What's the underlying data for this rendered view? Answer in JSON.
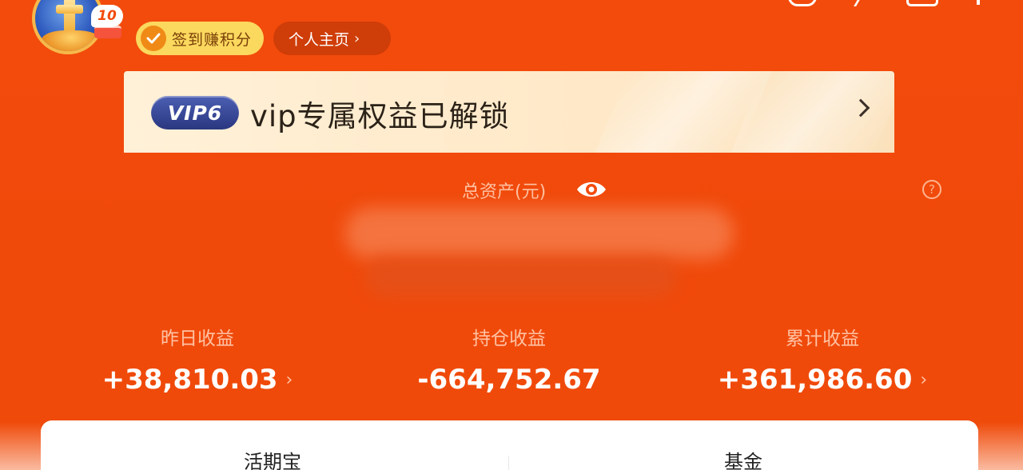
{
  "header": {
    "avatar_badge": "10",
    "checkin_label": "签到赚积分",
    "profile_label": "个人主页",
    "profile_chevron": "›"
  },
  "vip": {
    "badge": "VIP6",
    "text": "vip专属权益已解锁"
  },
  "assets": {
    "label": "总资产(元)",
    "help_symbol": "?",
    "value_hidden": true
  },
  "earnings": [
    {
      "label": "昨日收益",
      "value": "+38,810.03",
      "chevron": "›"
    },
    {
      "label": "持仓收益",
      "value": "-664,752.67",
      "chevron": ""
    },
    {
      "label": "累计收益",
      "value": "+361,986.60",
      "chevron": "›"
    }
  ],
  "tabs": [
    {
      "label": "活期宝"
    },
    {
      "label": "基金"
    }
  ],
  "colors": {
    "background": "#f24b0c",
    "vip_banner": "#fff1d8",
    "checkin_pill": "#fbd85e",
    "profile_pill": "#cf3d08"
  },
  "icons": [
    "avatar",
    "checkin-icon",
    "eye-icon",
    "help-icon",
    "chevron-right-icon"
  ]
}
